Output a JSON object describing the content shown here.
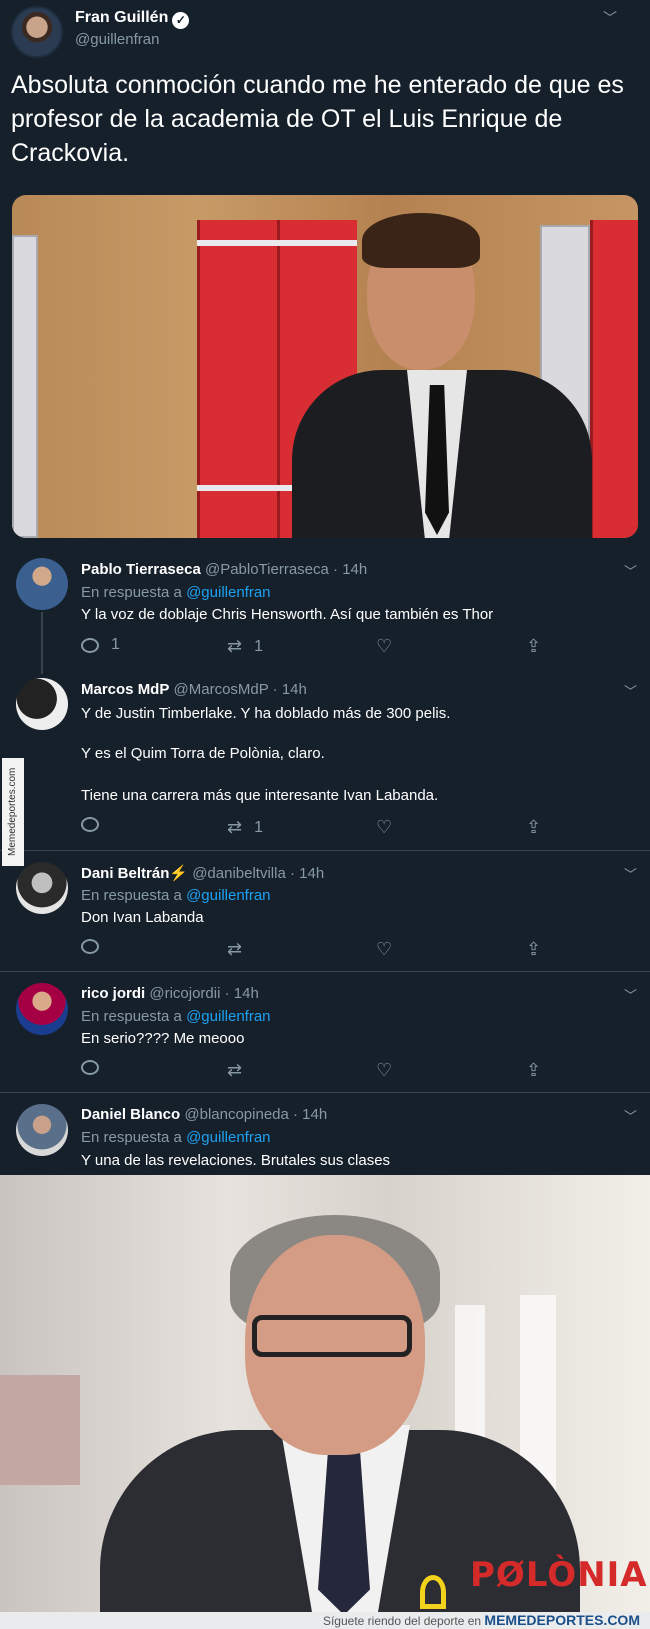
{
  "main_tweet": {
    "name": "Fran Guillén",
    "handle": "@guillenfran",
    "text": "Absoluta conmoción cuando me he enterado de que es profesor de la academia de OT el Luis Enrique de Crackovia."
  },
  "replies": [
    {
      "name": "Pablo Tierraseca",
      "handle": "@PabloTierraseca · 14h",
      "in_reply_prefix": "En respuesta a ",
      "in_reply_link": "@guillenfran",
      "text_lines": [
        "Y la voz de doblaje Chris Hensworth. Así que también es Thor"
      ],
      "reply_count": "1",
      "retweet_count": "1"
    },
    {
      "name": "Marcos MdP",
      "handle": "@MarcosMdP · 14h",
      "text_lines": [
        "Y de Justin Timberlake. Y ha doblado más de 300 pelis.",
        "Y es el Quim Torra de Polònia, claro.",
        "Tiene una carrera más que interesante Ivan Labanda."
      ],
      "reply_count": "",
      "retweet_count": "1"
    },
    {
      "name": "Dani Beltrán⚡",
      "handle": "@danibeltvilla · 14h",
      "in_reply_prefix": "En respuesta a ",
      "in_reply_link": "@guillenfran",
      "text_lines": [
        "Don Ivan Labanda"
      ]
    },
    {
      "name": "rico jordi",
      "handle": "@ricojordii · 14h",
      "in_reply_prefix": "En respuesta a ",
      "in_reply_link": "@guillenfran",
      "text_lines": [
        "En serio???? Me meooo"
      ]
    },
    {
      "name": "Daniel Blanco",
      "handle": "@blancopineda · 14h",
      "in_reply_prefix": "En respuesta a ",
      "in_reply_link": "@guillenfran",
      "text_lines": [
        "Y una de las revelaciones. Brutales sus clases"
      ]
    }
  ],
  "watermark": "Memedeportes.com",
  "logo_text": "PØLÒNIA",
  "footer": {
    "prefix": "Síguete riendo del deporte en ",
    "brand": "MEMEDEPORTES.COM"
  },
  "colors": {
    "background": "#15202b",
    "link": "#1da1f2",
    "muted": "#8899a6",
    "separator": "#38444d"
  }
}
